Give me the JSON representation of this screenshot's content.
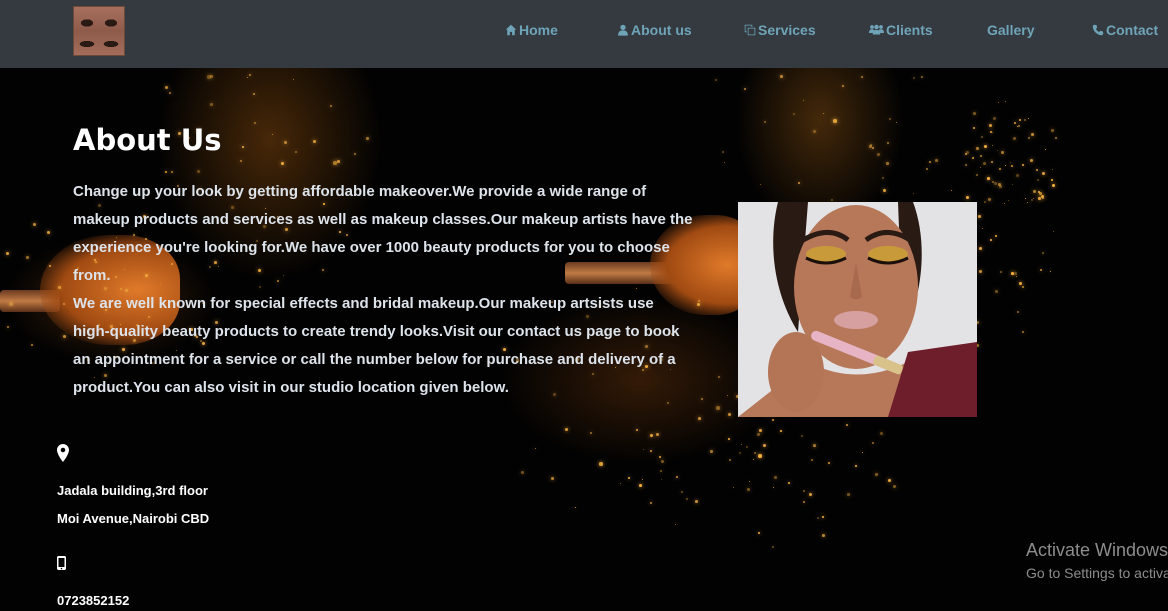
{
  "nav": {
    "logo_alt": "makeup eyes logo",
    "links": [
      {
        "label": "Home",
        "icon": "home-icon"
      },
      {
        "label": "About us",
        "icon": "user-icon"
      },
      {
        "label": "Services",
        "icon": "clone-icon"
      },
      {
        "label": "Clients",
        "icon": "users-icon"
      },
      {
        "label": "Gallery",
        "icon": ""
      },
      {
        "label": "Contact",
        "icon": "phone-icon"
      }
    ]
  },
  "about": {
    "title": "About Us",
    "paragraph1": "Change up your look by getting affordable makeover.We provide a wide range of makeup products and services as well as makeup classes.Our makeup artists have the experience you're looking for.We have over 1000 beauty products for you to choose from.",
    "paragraph2": "We are well known for special effects and bridal makeup.Our makeup artsists use high-quality beauty products to create trendy looks.Visit our contact us page to book an appointment for a service or call the number below for purchase and delivery of a product.You can also visit in our studio location given below."
  },
  "contact": {
    "location_icon": "map-marker-icon",
    "address_line1": "Jadala building,3rd floor",
    "address_line2": "Moi Avenue,Nairobi CBD",
    "phone_icon": "mobile-phone-icon",
    "phone": "0723852152"
  },
  "watermark": {
    "title": "Activate Windows",
    "subtitle": "Go to Settings to activate Windows."
  },
  "colors": {
    "navbar_bg": "#343a40",
    "nav_link": "#6fa4b8",
    "page_bg": "#020202",
    "text": "#dde3ea"
  }
}
